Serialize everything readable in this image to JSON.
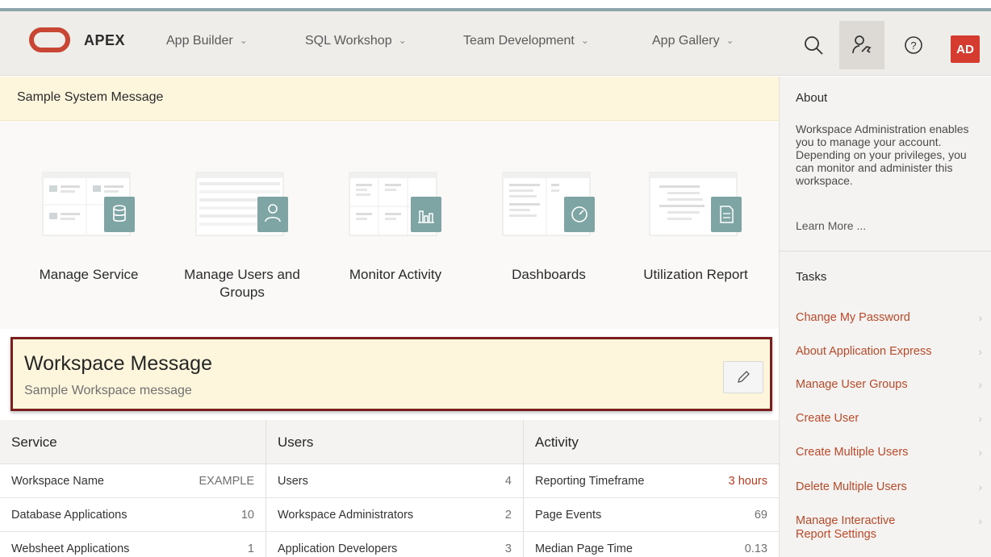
{
  "header": {
    "brand": "APEX",
    "nav": [
      {
        "label": "App Builder"
      },
      {
        "label": "SQL Workshop"
      },
      {
        "label": "Team Development"
      },
      {
        "label": "App Gallery"
      }
    ],
    "avatar": "AD",
    "icons": [
      "search-icon",
      "administration-icon",
      "help-icon"
    ]
  },
  "system_message": "Sample System Message",
  "cards": [
    {
      "label": "Manage Service",
      "icon": "database-icon"
    },
    {
      "label": "Manage Users and Groups",
      "icon": "user-icon"
    },
    {
      "label": "Monitor Activity",
      "icon": "bar-chart-icon"
    },
    {
      "label": "Dashboards",
      "icon": "gauge-icon"
    },
    {
      "label": "Utilization Report",
      "icon": "document-icon"
    }
  ],
  "workspace_message": {
    "title": "Workspace Message",
    "subtitle": "Sample Workspace message",
    "edit_icon": "pencil-icon"
  },
  "stats": {
    "service": {
      "title": "Service",
      "rows": [
        {
          "label": "Workspace Name",
          "value": "EXAMPLE"
        },
        {
          "label": "Database Applications",
          "value": "10"
        },
        {
          "label": "Websheet Applications",
          "value": "1"
        }
      ]
    },
    "users": {
      "title": "Users",
      "rows": [
        {
          "label": "Users",
          "value": "4"
        },
        {
          "label": "Workspace Administrators",
          "value": "2"
        },
        {
          "label": "Application Developers",
          "value": "3"
        }
      ]
    },
    "activity": {
      "title": "Activity",
      "rows": [
        {
          "label": "Reporting Timeframe",
          "value": "3 hours"
        },
        {
          "label": "Page Events",
          "value": "69"
        },
        {
          "label": "Median Page Time",
          "value": "0.13"
        }
      ]
    }
  },
  "sidebar": {
    "about_title": "About",
    "about_text": "Workspace Administration enables you to manage your account. Depending on your privileges, you can monitor and administer this workspace.",
    "learn_more": "Learn More ...",
    "tasks_title": "Tasks",
    "tasks": [
      {
        "label": "Change My Password"
      },
      {
        "label": "About Application Express"
      },
      {
        "label": "Manage User Groups"
      },
      {
        "label": "Create User"
      },
      {
        "label": "Create Multiple Users"
      },
      {
        "label": "Delete Multiple Users"
      },
      {
        "label": "Manage Interactive Report Settings"
      }
    ]
  },
  "colors": {
    "brand_red": "#c74634",
    "accent_teal": "#7fa4a4",
    "link": "#b84a2a",
    "highlight_border": "#7a1e1e",
    "message_bg": "#fdf6dd"
  }
}
